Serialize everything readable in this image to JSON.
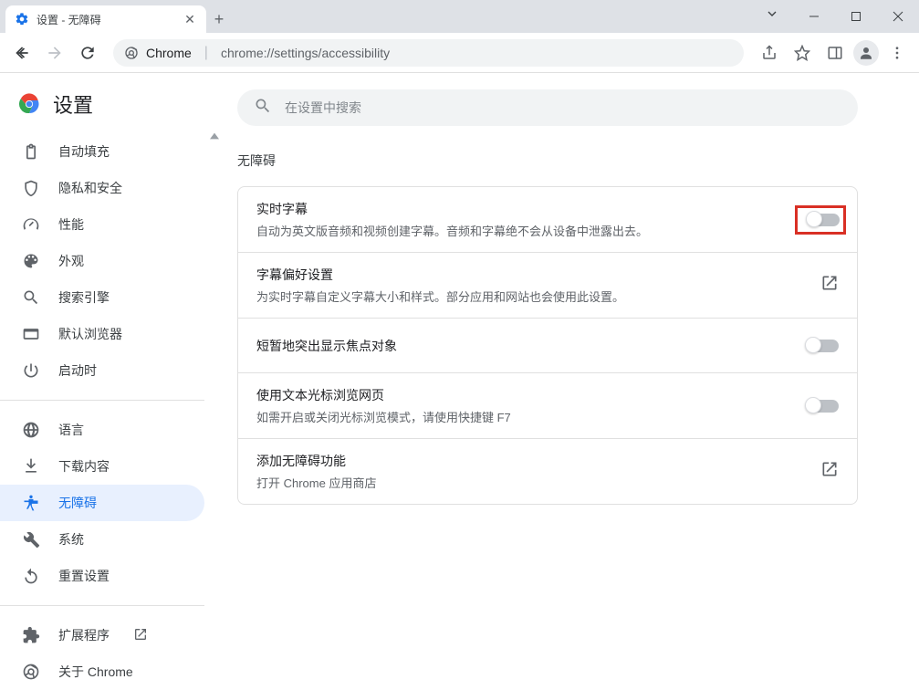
{
  "window": {
    "tab_title": "设置 - 无障碍"
  },
  "toolbar": {
    "url_scheme_label": "Chrome",
    "url_path": "chrome://settings/accessibility"
  },
  "header": {
    "title": "设置"
  },
  "sidebar": {
    "items": [
      {
        "label": "自动填充"
      },
      {
        "label": "隐私和安全"
      },
      {
        "label": "性能"
      },
      {
        "label": "外观"
      },
      {
        "label": "搜索引擎"
      },
      {
        "label": "默认浏览器"
      },
      {
        "label": "启动时"
      }
    ],
    "items2": [
      {
        "label": "语言"
      },
      {
        "label": "下载内容"
      },
      {
        "label": "无障碍"
      },
      {
        "label": "系统"
      },
      {
        "label": "重置设置"
      }
    ],
    "items3": [
      {
        "label": "扩展程序"
      },
      {
        "label": "关于 Chrome"
      }
    ]
  },
  "search": {
    "placeholder": "在设置中搜索"
  },
  "page": {
    "title": "无障碍"
  },
  "rows": [
    {
      "title": "实时字幕",
      "sub": "自动为英文版音频和视频创建字幕。音频和字幕绝不会从设备中泄露出去。"
    },
    {
      "title": "字幕偏好设置",
      "sub": "为实时字幕自定义字幕大小和样式。部分应用和网站也会使用此设置。"
    },
    {
      "title": "短暂地突出显示焦点对象"
    },
    {
      "title": "使用文本光标浏览网页",
      "sub": "如需开启或关闭光标浏览模式，请使用快捷键 F7"
    },
    {
      "title": "添加无障碍功能",
      "sub": "打开 Chrome 应用商店"
    }
  ]
}
